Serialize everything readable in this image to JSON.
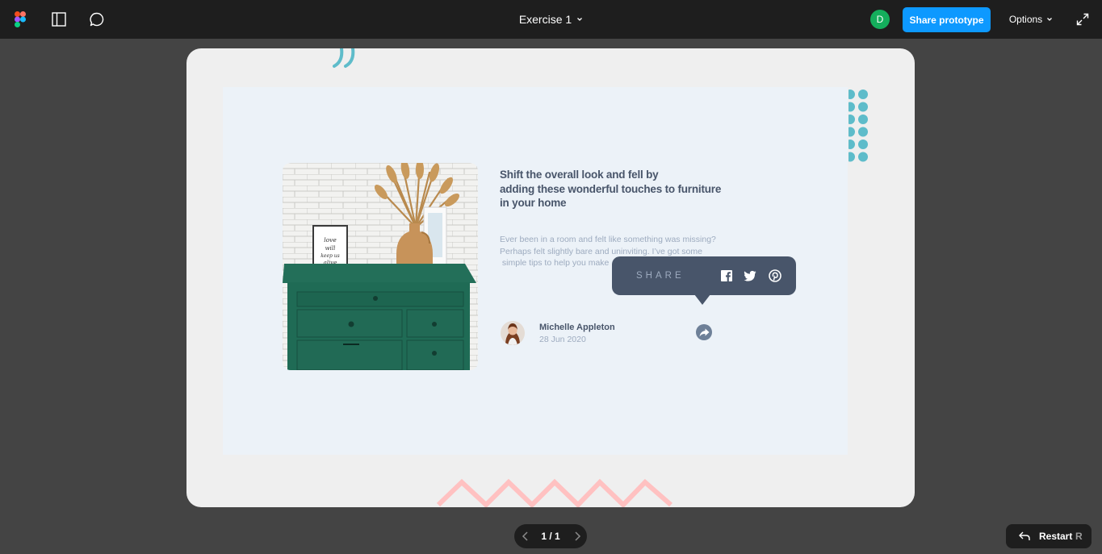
{
  "toolbar": {
    "file_title": "Exercise 1",
    "user_initial": "D",
    "share_label": "Share prototype",
    "options_label": "Options"
  },
  "article": {
    "headline_lines": [
      "Shift the overall look and fell by",
      "adding these wonderful touches to furniture",
      "in your home"
    ],
    "excerpt_lines": [
      "Ever been in a room and felt like something was missing?",
      "Perhaps felt slightly bare and uninviting. I’ve got some",
      " simple tips to help you make"
    ],
    "author_name": "Michelle Appleton",
    "date": "28 Jun 2020",
    "photo_frame_text": "love will keep us alive"
  },
  "share_tooltip": {
    "label": "SHARE",
    "networks": [
      "facebook",
      "twitter",
      "pinterest"
    ]
  },
  "pager": {
    "page_text": "1 / 1"
  },
  "restart": {
    "label": "Restart",
    "shortcut": "R"
  },
  "colors": {
    "toolbar_bg": "#1e1e1e",
    "canvas_bg": "#444444",
    "accent_blue": "#0d99ff",
    "user_green": "#14ae5c",
    "card_bg": "#ecf2f8",
    "dark_slate": "#48556a",
    "grayish_blue": "#9dabbf",
    "teal_deco": "#5ebcca",
    "pink_deco": "#ffc1c1",
    "drawer_green": "#1f6b55"
  },
  "icons": {
    "logo": "figma-logo-icon",
    "panel": "sidebar-panel-icon",
    "comment": "comment-bubble-icon",
    "expand": "expand-arrows-icon",
    "share": "share-arrow-icon",
    "prev": "chevron-left-icon",
    "next": "chevron-right-icon",
    "restart": "restart-arrow-icon"
  }
}
